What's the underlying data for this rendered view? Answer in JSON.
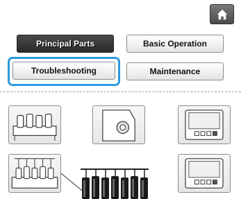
{
  "header": {
    "home_icon": "home-icon"
  },
  "menu": {
    "principal_parts_label": "Principal Parts",
    "basic_operation_label": "Basic Operation",
    "troubleshooting_label": "Troubleshooting",
    "maintenance_label": "Maintenance",
    "selected": "Principal Parts",
    "focused": "Troubleshooting"
  },
  "thumbnails": [
    {
      "icon": "spool-stand-icon"
    },
    {
      "icon": "knob-icon"
    },
    {
      "icon": "control-panel-icon"
    },
    {
      "icon": "thread-guide-icon"
    },
    {
      "icon": "control-panel-icon"
    }
  ],
  "colors": {
    "accent": "#2a9be0",
    "dark_button": "#3a3a3a",
    "button_border": "#8c8c8c"
  }
}
